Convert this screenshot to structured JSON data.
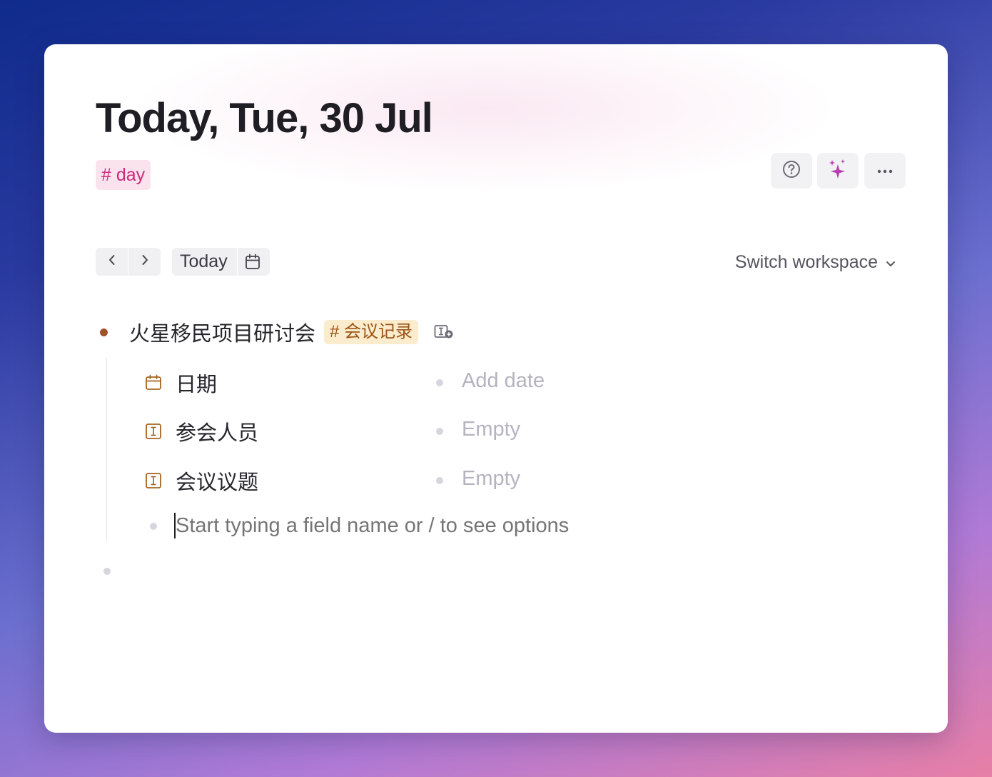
{
  "page": {
    "title": "Today, Tue, 30 Jul",
    "supertag": "# day"
  },
  "toolbar": {
    "help_icon": "question-circle",
    "ai_icon": "sparkles",
    "more_icon": "ellipsis-horizontal"
  },
  "nav": {
    "prev_icon": "chevron-left",
    "next_icon": "chevron-right",
    "today_label": "Today",
    "calendar_icon": "calendar",
    "switch_workspace_label": "Switch workspace"
  },
  "node": {
    "title": "火星移民项目研讨会",
    "tag": "# 会议记录",
    "bullet_color": "#a0522d",
    "fields": [
      {
        "icon": "calendar",
        "label": "日期",
        "value": "Add date"
      },
      {
        "icon": "text-field",
        "label": "参会人员",
        "value": "Empty"
      },
      {
        "icon": "text-field",
        "label": "会议议题",
        "value": "Empty"
      }
    ],
    "new_field_placeholder": "Start typing a field name or / to see options"
  },
  "colors": {
    "day_tag_bg": "#fbe3ee",
    "day_tag_text": "#cc2a7c",
    "meeting_tag_bg": "#fbeccd",
    "meeting_tag_text": "#9a5416",
    "field_icon": "#a8641f"
  }
}
